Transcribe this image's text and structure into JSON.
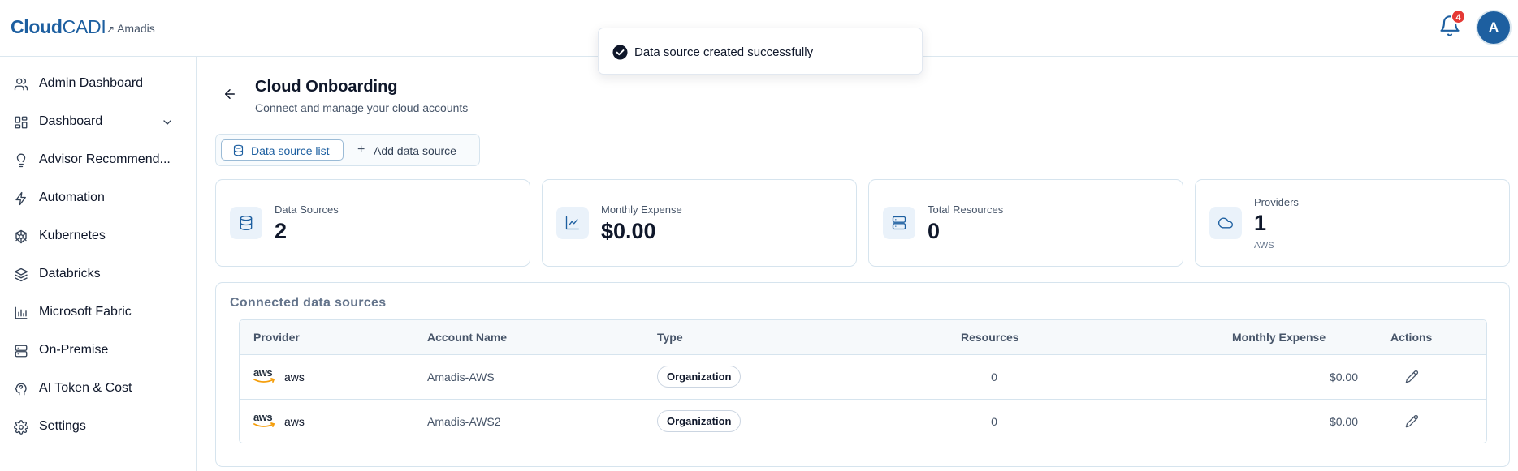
{
  "header": {
    "logo_bold": "Cloud",
    "logo_light": "CADI",
    "tenant_arrow": "↗",
    "tenant": "Amadis",
    "notification_count": "4",
    "avatar_initial": "A"
  },
  "toast": {
    "message": "Data source created successfully"
  },
  "sidebar": {
    "items": [
      {
        "label": "Admin Dashboard",
        "icon": "users-icon"
      },
      {
        "label": "Dashboard",
        "icon": "dashboard-icon",
        "expandable": true
      },
      {
        "label": "Advisor Recommend...",
        "icon": "lightbulb-icon"
      },
      {
        "label": "Automation",
        "icon": "zap-icon"
      },
      {
        "label": "Kubernetes",
        "icon": "kubernetes-icon"
      },
      {
        "label": "Databricks",
        "icon": "layers-icon"
      },
      {
        "label": "Microsoft Fabric",
        "icon": "bar-chart-icon"
      },
      {
        "label": "On-Premise",
        "icon": "server-icon"
      },
      {
        "label": "AI Token & Cost",
        "icon": "brain-icon"
      },
      {
        "label": "Settings",
        "icon": "gear-icon"
      }
    ]
  },
  "page": {
    "title": "Cloud Onboarding",
    "subtitle": "Connect and manage your cloud accounts"
  },
  "tabs": {
    "list": "Data source list",
    "add": "Add data source"
  },
  "stats": [
    {
      "label": "Data Sources",
      "value": "2",
      "icon": "database-icon"
    },
    {
      "label": "Monthly Expense",
      "value": "$0.00",
      "icon": "line-chart-icon"
    },
    {
      "label": "Total Resources",
      "value": "0",
      "icon": "server-icon"
    },
    {
      "label": "Providers",
      "value": "1",
      "sub": "AWS",
      "icon": "cloud-icon"
    }
  ],
  "table": {
    "title": "Connected data sources",
    "columns": [
      "Provider",
      "Account Name",
      "Type",
      "Resources",
      "Monthly Expense",
      "Actions"
    ],
    "logo_text": "aws",
    "rows": [
      {
        "provider": "aws",
        "account": "Amadis-AWS",
        "type": "Organization",
        "resources": "0",
        "expense": "$0.00"
      },
      {
        "provider": "aws",
        "account": "Amadis-AWS2",
        "type": "Organization",
        "resources": "0",
        "expense": "$0.00"
      }
    ]
  },
  "colors": {
    "brand": "#1d5fa0",
    "badge": "#e53935",
    "border": "#d6e4ee"
  }
}
